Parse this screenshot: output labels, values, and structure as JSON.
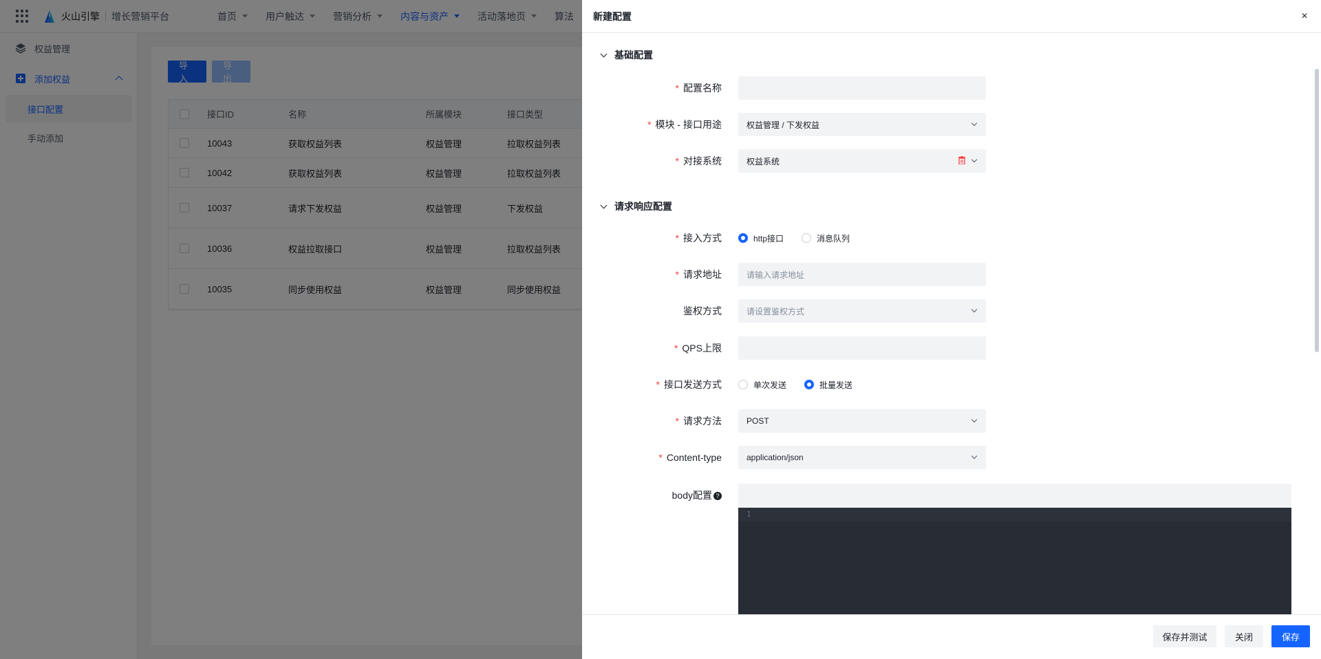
{
  "topbar": {
    "brand": "火山引擎",
    "product": "增长营销平台",
    "nav": [
      {
        "label": "首页"
      },
      {
        "label": "用户触达"
      },
      {
        "label": "营销分析"
      },
      {
        "label": "内容与资产"
      },
      {
        "label": "活动落地页"
      },
      {
        "label": "算法"
      }
    ],
    "active_nav": "内容与资产"
  },
  "sidebar": {
    "groups": [
      {
        "label": "权益管理",
        "icon": "layers-icon"
      },
      {
        "label": "添加权益",
        "icon": "plus-square-icon"
      }
    ],
    "subitems": [
      {
        "label": "接口配置"
      },
      {
        "label": "手动添加"
      }
    ]
  },
  "toolbar": {
    "import_label": "导入",
    "export_label": "导出"
  },
  "table": {
    "columns": [
      "接口ID",
      "名称",
      "所属模块",
      "接口类型"
    ],
    "rows": [
      {
        "id": "10043",
        "name": "获取权益列表",
        "module": "权益管理",
        "type": "拉取权益列表"
      },
      {
        "id": "10042",
        "name": "获取权益列表",
        "module": "权益管理",
        "type": "拉取权益列表"
      },
      {
        "id": "10037",
        "name": "请求下发权益",
        "module": "权益管理",
        "type": "下发权益"
      },
      {
        "id": "10036",
        "name": "权益拉取接口",
        "module": "权益管理",
        "type": "拉取权益列表"
      },
      {
        "id": "10035",
        "name": "同步使用权益",
        "module": "权益管理",
        "type": "同步使用权益"
      }
    ]
  },
  "drawer": {
    "title": "新建配置",
    "close_label": "×",
    "section_basic": "基础配置",
    "section_request": "请求响应配置",
    "fields": {
      "config_name": {
        "label": "配置名称",
        "value": ""
      },
      "module_usage": {
        "label": "模块 - 接口用途",
        "value": "权益管理 / 下发权益"
      },
      "system": {
        "label": "对接系统",
        "value": "权益系统"
      },
      "access_mode": {
        "label": "接入方式",
        "options": [
          "http接口",
          "消息队列"
        ],
        "selected": "http接口"
      },
      "request_url": {
        "label": "请求地址",
        "placeholder": "请输入请求地址"
      },
      "auth": {
        "label": "鉴权方式",
        "placeholder": "请设置鉴权方式"
      },
      "qps": {
        "label": "QPS上限",
        "value": ""
      },
      "send_mode": {
        "label": "接口发送方式",
        "options": [
          "单次发送",
          "批量发送"
        ],
        "selected": "批量发送"
      },
      "method": {
        "label": "请求方法",
        "value": "POST"
      },
      "content_type": {
        "label": "Content-type",
        "value": "application/json"
      },
      "body": {
        "label": "body配置",
        "help": "?",
        "line_number": "1"
      }
    },
    "footer": {
      "save_test_label": "保存并测试",
      "close_label": "关闭",
      "save_label": "保存"
    }
  }
}
